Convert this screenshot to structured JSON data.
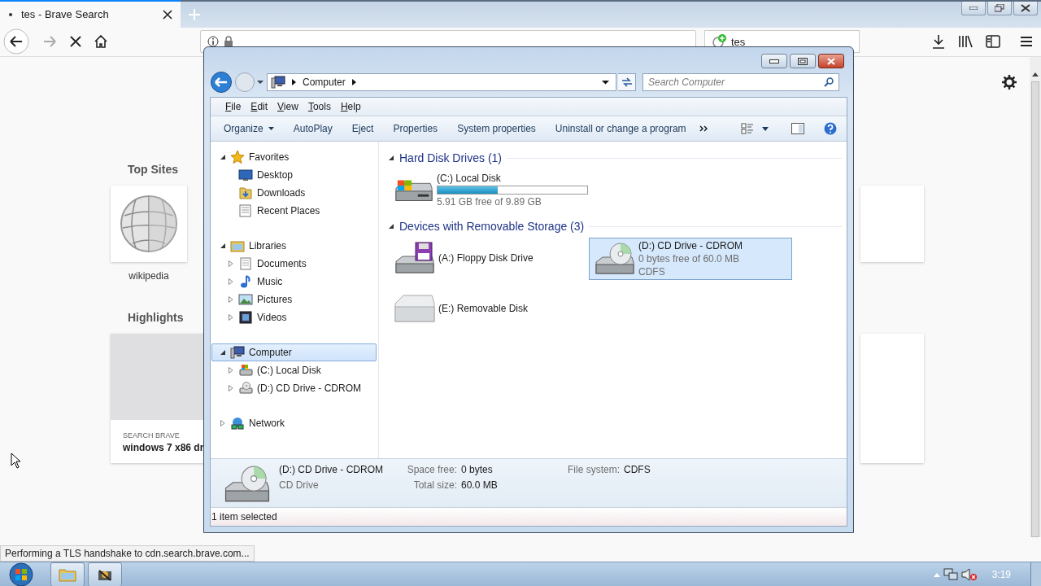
{
  "browser": {
    "tab_title": "tes - Brave Search",
    "search_value": "tes",
    "top_sites": {
      "heading": "Top Sites",
      "sites": [
        {
          "label": "wikipedia"
        }
      ]
    },
    "highlights": {
      "heading": "Highlights",
      "cards": [
        {
          "source": "SEARCH BRAVE",
          "title": "windows 7 x86 dr"
        }
      ]
    },
    "status": "Performing a TLS handshake to cdn.search.brave.com..."
  },
  "explorer": {
    "breadcrumb": [
      "Computer"
    ],
    "search_placeholder": "Search Computer",
    "menu": [
      "File",
      "Edit",
      "View",
      "Tools",
      "Help"
    ],
    "commands": [
      {
        "label": "Organize",
        "kind": "menu"
      },
      {
        "label": "AutoPlay",
        "kind": "plain"
      },
      {
        "label": "Eject",
        "kind": "plain"
      },
      {
        "label": "Properties",
        "kind": "plain"
      },
      {
        "label": "System properties",
        "kind": "plain"
      },
      {
        "label": "Uninstall or change a program",
        "kind": "plain"
      }
    ],
    "nav": [
      {
        "label": "Favorites",
        "kind": "star",
        "expanded": true,
        "selected": false,
        "children": [
          {
            "label": "Desktop",
            "kind": "desktop",
            "selected": false
          },
          {
            "label": "Downloads",
            "kind": "folder",
            "selected": false
          },
          {
            "label": "Recent Places",
            "kind": "recent",
            "selected": false
          }
        ]
      },
      {
        "label": "Libraries",
        "kind": "library",
        "expanded": true,
        "selected": false,
        "children": [
          {
            "label": "Documents",
            "kind": "document",
            "expanded": false,
            "selected": false
          },
          {
            "label": "Music",
            "kind": "music",
            "expanded": false,
            "selected": false
          },
          {
            "label": "Pictures",
            "kind": "pictures",
            "expanded": false,
            "selected": false
          },
          {
            "label": "Videos",
            "kind": "video",
            "expanded": false,
            "selected": false
          }
        ]
      },
      {
        "label": "Computer",
        "kind": "computer",
        "expanded": true,
        "selected": true,
        "children": [
          {
            "label": "(C:) Local Disk",
            "kind": "hdd",
            "expanded": false,
            "selected": false
          },
          {
            "label": "(D:) CD Drive - CDROM",
            "kind": "cd",
            "expanded": false,
            "selected": false
          }
        ]
      },
      {
        "label": "Network",
        "kind": "network",
        "expanded": false,
        "selected": false
      }
    ],
    "groups": [
      {
        "title": "Hard Disk Drives (1)",
        "items": [
          {
            "name": "(C:) Local Disk",
            "kind": "hdd",
            "selected": false,
            "level": 0.4,
            "lines": [
              "5.91 GB free of 9.89 GB"
            ]
          }
        ]
      },
      {
        "title": "Devices with Removable Storage (3)",
        "items": [
          {
            "name": "(A:) Floppy Disk Drive",
            "kind": "floppy",
            "selected": false
          },
          {
            "name": "(D:) CD Drive - CDROM",
            "kind": "cd",
            "selected": true,
            "lines": [
              "0 bytes free of 60.0 MB",
              "CDFS"
            ]
          },
          {
            "name": "(E:) Removable Disk",
            "kind": "removable",
            "selected": false
          }
        ]
      }
    ],
    "details": {
      "name": "(D:) CD Drive - CDROM",
      "type": "CD Drive",
      "fields": [
        {
          "label": "Space free:",
          "value": "0 bytes"
        },
        {
          "label": "Total size:",
          "value": "60.0 MB"
        },
        {
          "label": "File system:",
          "value": "CDFS"
        }
      ]
    },
    "status": "1 item selected"
  },
  "taskbar": {
    "apps": [
      {
        "kind": "explorer"
      },
      {
        "kind": "app"
      }
    ],
    "clock": "3:19"
  }
}
